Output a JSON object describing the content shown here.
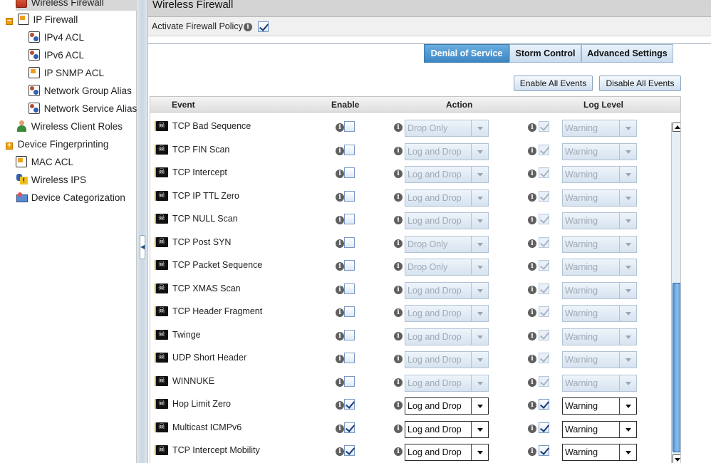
{
  "sidebar": {
    "items": [
      {
        "label": "Wireless Firewall",
        "icon": "firewall-icon"
      },
      {
        "label": "IP Firewall",
        "icon": "document-icon"
      },
      {
        "label": "IPv4 ACL",
        "icon": "users-icon"
      },
      {
        "label": "IPv6 ACL",
        "icon": "users-icon"
      },
      {
        "label": "IP SNMP ACL",
        "icon": "document-icon"
      },
      {
        "label": "Network Group Alias",
        "icon": "users-icon"
      },
      {
        "label": "Network Service Alias",
        "icon": "users-icon"
      },
      {
        "label": "Wireless Client Roles",
        "icon": "person-icon"
      },
      {
        "label": "Device Fingerprinting",
        "icon": "expander-icon"
      },
      {
        "label": "MAC ACL",
        "icon": "document-icon"
      },
      {
        "label": "Wireless IPS",
        "icon": "ips-warning-icon"
      },
      {
        "label": "Device Categorization",
        "icon": "categorization-icon"
      }
    ]
  },
  "header": {
    "title": "Wireless Firewall"
  },
  "policy": {
    "label": "Activate Firewall Policy",
    "checked": true
  },
  "tabs": [
    {
      "label": "Denial of Service",
      "active": true
    },
    {
      "label": "Storm Control",
      "active": false
    },
    {
      "label": "Advanced Settings",
      "active": false
    }
  ],
  "buttons": {
    "enable_all": "Enable All Events",
    "disable_all": "Disable All Events"
  },
  "table": {
    "columns": [
      "Event",
      "Enable",
      "Action",
      "Log Level"
    ],
    "rows": [
      {
        "event": "TCP Bad Sequence",
        "enabled": false,
        "action": "Drop Only",
        "log": true,
        "level": "Warning"
      },
      {
        "event": "TCP FIN Scan",
        "enabled": false,
        "action": "Log and Drop",
        "log": true,
        "level": "Warning"
      },
      {
        "event": "TCP Intercept",
        "enabled": false,
        "action": "Log and Drop",
        "log": true,
        "level": "Warning"
      },
      {
        "event": "TCP IP TTL Zero",
        "enabled": false,
        "action": "Log and Drop",
        "log": true,
        "level": "Warning"
      },
      {
        "event": "TCP NULL Scan",
        "enabled": false,
        "action": "Log and Drop",
        "log": true,
        "level": "Warning"
      },
      {
        "event": "TCP Post SYN",
        "enabled": false,
        "action": "Drop Only",
        "log": true,
        "level": "Warning"
      },
      {
        "event": "TCP Packet Sequence",
        "enabled": false,
        "action": "Drop Only",
        "log": true,
        "level": "Warning"
      },
      {
        "event": "TCP XMAS Scan",
        "enabled": false,
        "action": "Log and Drop",
        "log": true,
        "level": "Warning"
      },
      {
        "event": "TCP Header Fragment",
        "enabled": false,
        "action": "Log and Drop",
        "log": true,
        "level": "Warning"
      },
      {
        "event": "Twinge",
        "enabled": false,
        "action": "Log and Drop",
        "log": true,
        "level": "Warning"
      },
      {
        "event": "UDP Short Header",
        "enabled": false,
        "action": "Log and Drop",
        "log": true,
        "level": "Warning"
      },
      {
        "event": "WINNUKE",
        "enabled": false,
        "action": "Log and Drop",
        "log": true,
        "level": "Warning"
      },
      {
        "event": "Hop Limit Zero",
        "enabled": true,
        "action": "Log and Drop",
        "log": true,
        "level": "Warning"
      },
      {
        "event": "Multicast ICMPv6",
        "enabled": true,
        "action": "Log and Drop",
        "log": true,
        "level": "Warning"
      },
      {
        "event": "TCP Intercept Mobility",
        "enabled": true,
        "action": "Log and Drop",
        "log": true,
        "level": "Warning"
      }
    ]
  },
  "colors": {
    "tab_active": "#3b86c4",
    "selected_nav": "#d7d7d7",
    "scroll_thumb": "#4f94d4"
  }
}
